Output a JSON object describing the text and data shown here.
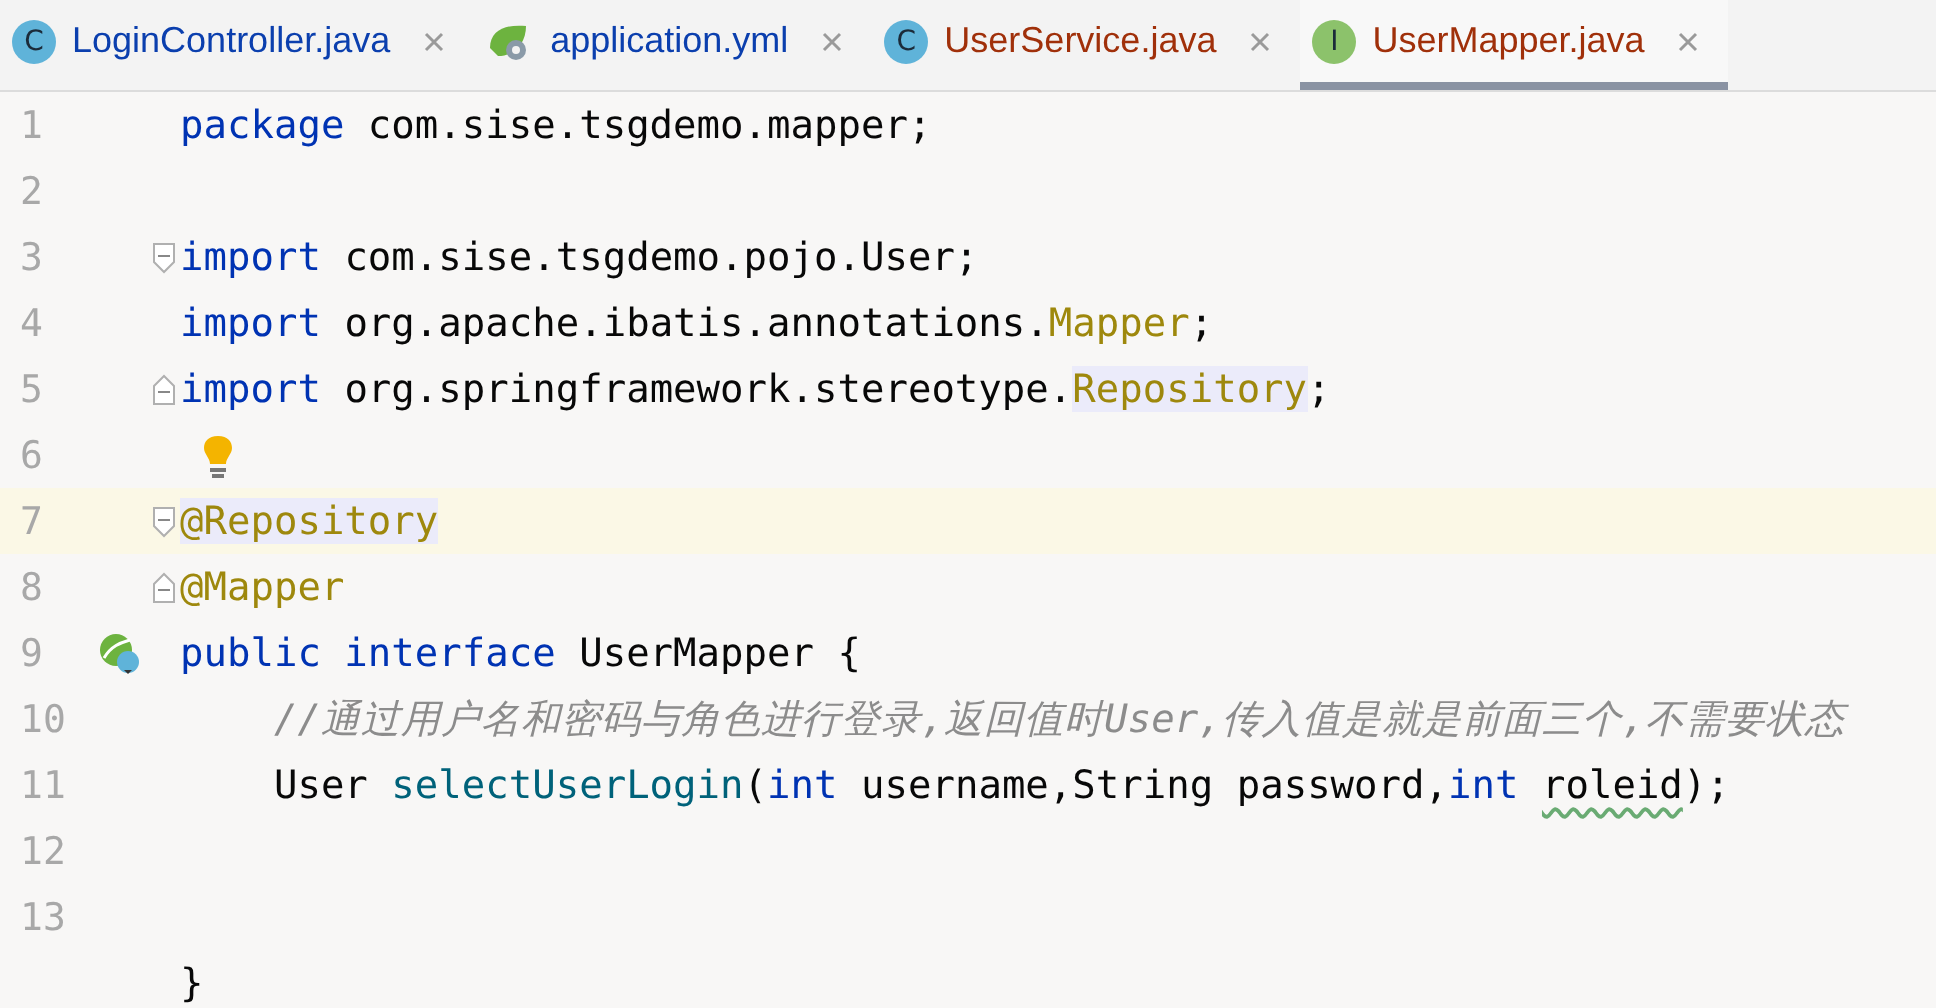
{
  "tabs": [
    {
      "label": "LoginController.java",
      "kind": "class",
      "icon_letter": "C",
      "color": "#0b3fae",
      "selected": false
    },
    {
      "label": "application.yml",
      "kind": "config",
      "color": "#0b3fae",
      "selected": false
    },
    {
      "label": "UserService.java",
      "kind": "class",
      "icon_letter": "C",
      "color": "#a0300a",
      "selected": false
    },
    {
      "label": "UserMapper.java",
      "kind": "interface",
      "icon_letter": "I",
      "color": "#a0300a",
      "selected": true
    }
  ],
  "lines": [
    {
      "number": "1",
      "current": false,
      "tokens": [
        {
          "kind": "keyword",
          "text": "package"
        },
        {
          "kind": "plain",
          "text": " com.sise.tsgdemo.mapper;"
        }
      ]
    },
    {
      "number": "2",
      "current": false
    },
    {
      "number": "3",
      "current": false,
      "fold_start": true,
      "tokens": [
        {
          "kind": "keyword",
          "text": "import"
        },
        {
          "kind": "plain",
          "text": " com.sise.tsgdemo.pojo.User;"
        }
      ]
    },
    {
      "number": "4",
      "current": false,
      "tokens": [
        {
          "kind": "keyword",
          "text": "import"
        },
        {
          "kind": "plain",
          "text": " org.apache.ibatis.annotations."
        },
        {
          "kind": "annotation",
          "text": "Mapper"
        },
        {
          "kind": "plain",
          "text": ";"
        }
      ]
    },
    {
      "number": "5",
      "current": false,
      "fold_end": true,
      "tokens": [
        {
          "kind": "keyword",
          "text": "import"
        },
        {
          "kind": "plain",
          "text": " org.springframework.stereotype."
        },
        {
          "kind": "annotation",
          "text": "Repository",
          "highlight": true
        },
        {
          "kind": "plain",
          "text": ";"
        }
      ]
    },
    {
      "number": "6",
      "current": false,
      "bulb": true
    },
    {
      "number": "7",
      "current": true,
      "fold_start": true,
      "tokens": [
        {
          "kind": "annotation",
          "text": "@Repository",
          "highlight": true
        }
      ]
    },
    {
      "number": "8",
      "current": false,
      "fold_end": true,
      "tokens": [
        {
          "kind": "annotation",
          "text": "@Mapper"
        }
      ]
    },
    {
      "number": "9",
      "current": false,
      "bean_icon": true,
      "tokens": [
        {
          "kind": "keyword",
          "text": "public interface"
        },
        {
          "kind": "plain",
          "text": " UserMapper {"
        }
      ]
    },
    {
      "number": "10",
      "current": false,
      "tokens": [
        {
          "kind": "comment",
          "text": "    //通过用户名和密码与角色进行登录,返回值时User,传入值是就是前面三个,不需要状态"
        }
      ]
    },
    {
      "number": "11",
      "current": false,
      "tokens": [
        {
          "kind": "plain",
          "text": "    User "
        },
        {
          "kind": "method",
          "text": "selectUserLogin"
        },
        {
          "kind": "plain",
          "text": "("
        },
        {
          "kind": "keyword",
          "text": "int"
        },
        {
          "kind": "plain",
          "text": " username,String password,"
        },
        {
          "kind": "keyword",
          "text": "int "
        },
        {
          "kind": "plain",
          "text": "roleid",
          "typo": true
        },
        {
          "kind": "plain",
          "text": ");"
        }
      ]
    },
    {
      "number": "12",
      "current": false
    },
    {
      "number": "13",
      "current": false
    },
    {
      "current": false,
      "tokens": [
        {
          "kind": "plain",
          "text": "}"
        }
      ]
    }
  ]
}
